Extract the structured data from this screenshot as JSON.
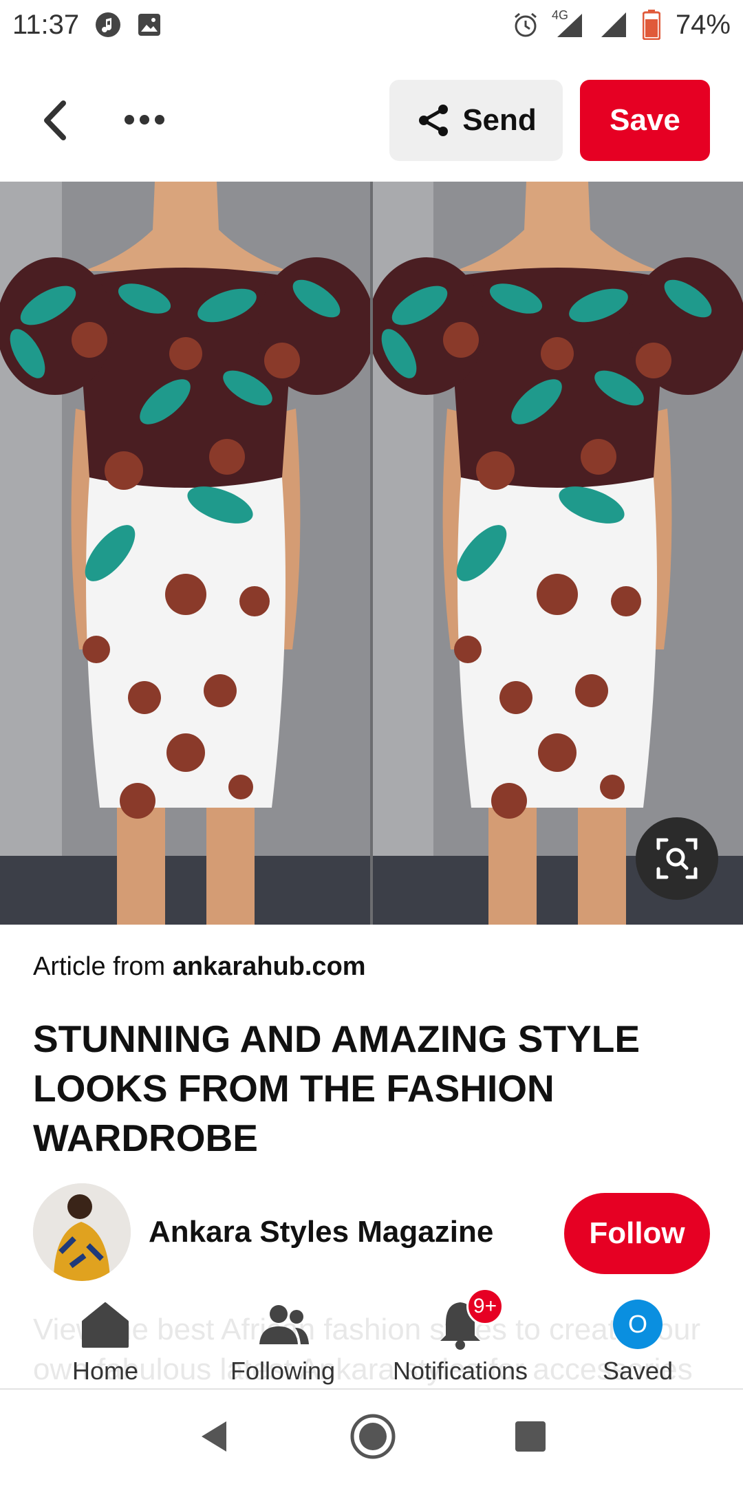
{
  "status_bar": {
    "time": "11:37",
    "battery": "74%",
    "network": "4G"
  },
  "toolbar": {
    "send_label": "Send",
    "save_label": "Save"
  },
  "pin": {
    "article_prefix": "Article from",
    "article_source": "ankarahub.com",
    "title": "STUNNING AND AMAZING STYLE LOOKS FROM THE FASHION WARDROBE",
    "creator_name": "Ankara Styles Magazine",
    "follow_label": "Follow",
    "description": "View the best African fashion styles to create your own fabulous latest Ankara styles for accessories"
  },
  "bottom_nav": {
    "home": "Home",
    "following": "Following",
    "notifications": "Notifications",
    "notifications_badge": "9+",
    "saved": "Saved",
    "saved_initial": "O"
  },
  "colors": {
    "brand_red": "#e60023",
    "saved_blue": "#0a8fe0"
  }
}
